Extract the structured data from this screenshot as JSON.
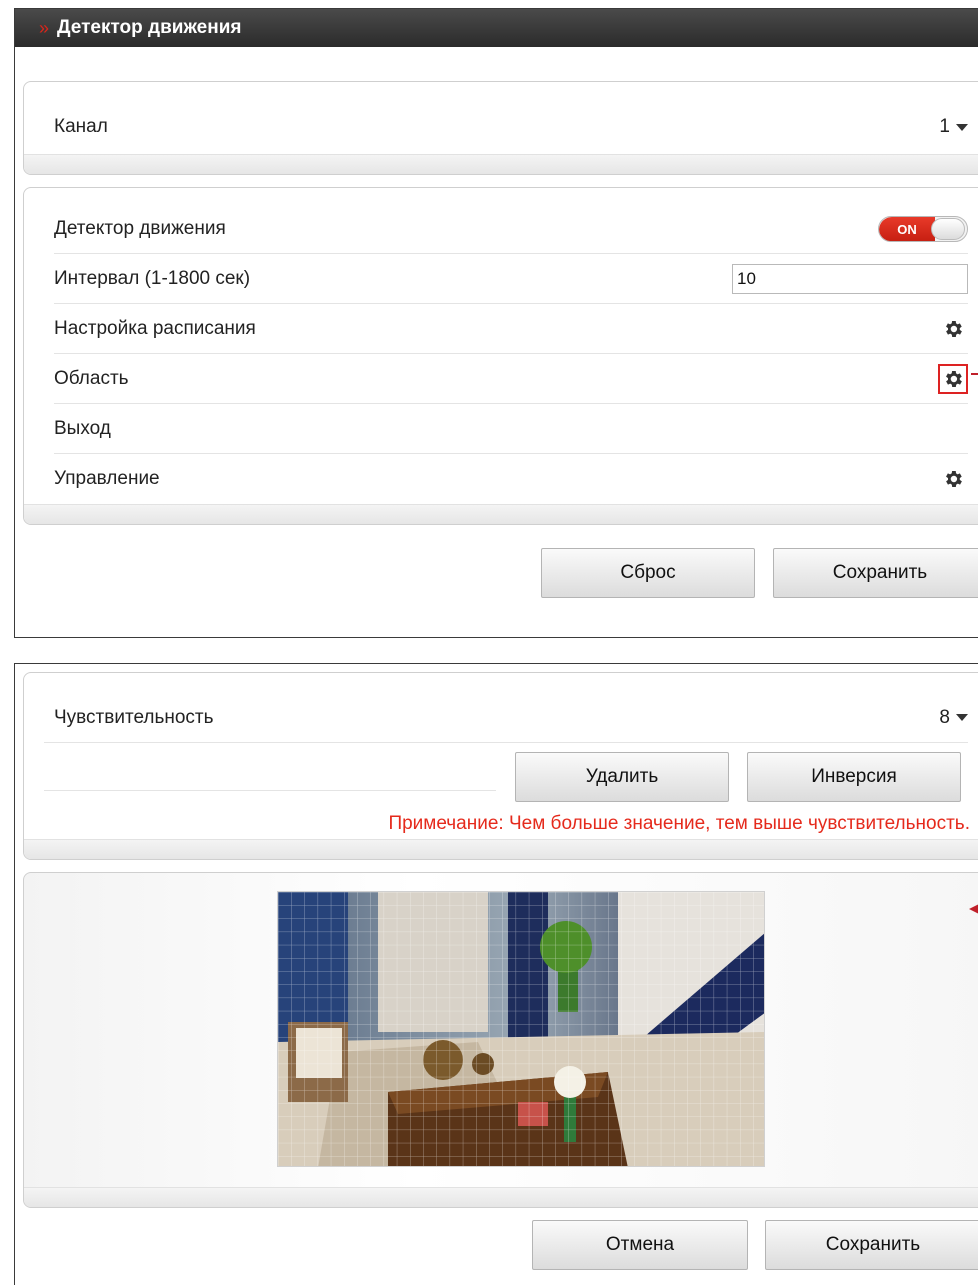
{
  "top_panel": {
    "title": "Детектор движения",
    "channel": {
      "label": "Канал",
      "value": "1"
    },
    "settings": [
      {
        "label": "Детектор движения"
      },
      {
        "label": "Интервал (1-1800 сек)"
      },
      {
        "label": "Настройка расписания"
      },
      {
        "label": "Область"
      },
      {
        "label": "Выход"
      },
      {
        "label": "Управление"
      }
    ],
    "toggle_label": "ON",
    "interval_value": "10",
    "reset_button": "Сброс",
    "save_button": "Сохранить"
  },
  "bottom_panel": {
    "sensitivity": {
      "label": "Чувствительность",
      "value": "8"
    },
    "delete_button": "Удалить",
    "invert_button": "Инверсия",
    "note": "Примечание: Чем больше значение, тем выше чувствительность.",
    "cancel_button": "Отмена",
    "save_button": "Сохранить"
  },
  "colors": {
    "title_bar": "#2b2b2b",
    "accent_red": "#d8261b",
    "note_red": "#e52a1c"
  },
  "icons": [
    "chevron-right-icon",
    "caret-down-icon",
    "gear-icon"
  ]
}
